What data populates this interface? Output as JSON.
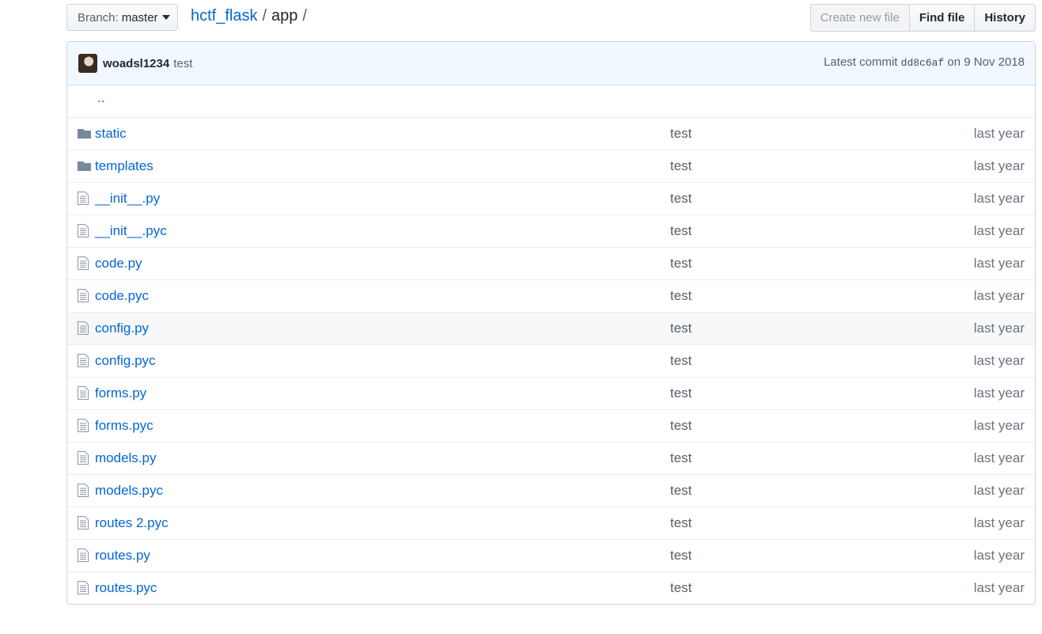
{
  "toolbar": {
    "branch_label": "Branch:",
    "branch_value": "master",
    "breadcrumb": {
      "repo": "hctf_flask",
      "sep1": "/",
      "folder": "app",
      "sep2": "/"
    },
    "create_new_file": "Create new file",
    "find_file": "Find file",
    "history": "History"
  },
  "commit": {
    "author": "woadsl1234",
    "message": "test",
    "latest_label": "Latest commit",
    "sha": "dd8c6af",
    "date": "on 9 Nov 2018"
  },
  "updir": "..",
  "files": [
    {
      "name": "static",
      "type": "folder",
      "message": "test",
      "age": "last year"
    },
    {
      "name": "templates",
      "type": "folder",
      "message": "test",
      "age": "last year"
    },
    {
      "name": "__init__.py",
      "type": "file",
      "message": "test",
      "age": "last year"
    },
    {
      "name": "__init__.pyc",
      "type": "file",
      "message": "test",
      "age": "last year"
    },
    {
      "name": "code.py",
      "type": "file",
      "message": "test",
      "age": "last year"
    },
    {
      "name": "code.pyc",
      "type": "file",
      "message": "test",
      "age": "last year"
    },
    {
      "name": "config.py",
      "type": "file",
      "message": "test",
      "age": "last year"
    },
    {
      "name": "config.pyc",
      "type": "file",
      "message": "test",
      "age": "last year"
    },
    {
      "name": "forms.py",
      "type": "file",
      "message": "test",
      "age": "last year"
    },
    {
      "name": "forms.pyc",
      "type": "file",
      "message": "test",
      "age": "last year"
    },
    {
      "name": "models.py",
      "type": "file",
      "message": "test",
      "age": "last year"
    },
    {
      "name": "models.pyc",
      "type": "file",
      "message": "test",
      "age": "last year"
    },
    {
      "name": "routes 2.pyc",
      "type": "file",
      "message": "test",
      "age": "last year"
    },
    {
      "name": "routes.py",
      "type": "file",
      "message": "test",
      "age": "last year"
    },
    {
      "name": "routes.pyc",
      "type": "file",
      "message": "test",
      "age": "last year"
    }
  ]
}
